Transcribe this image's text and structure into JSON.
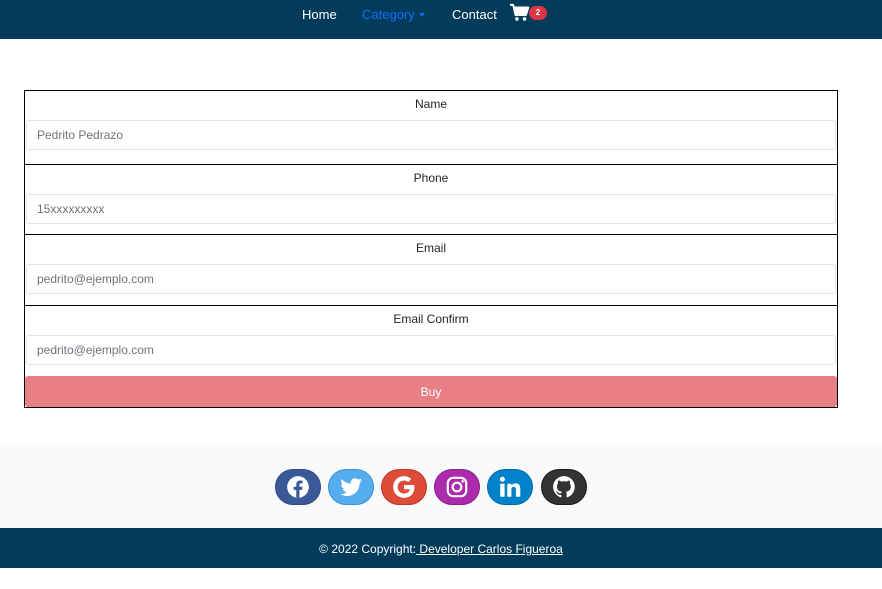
{
  "nav": {
    "home": "Home",
    "category": "Category",
    "contact": "Contact",
    "cart_count": "2"
  },
  "form": {
    "name": {
      "label": "Name",
      "placeholder": "Pedrito Pedrazo"
    },
    "phone": {
      "label": "Phone",
      "placeholder": "15xxxxxxxxx"
    },
    "email": {
      "label": "Email",
      "placeholder": "pedrito@ejemplo.com"
    },
    "email_confirm": {
      "label": "Email Confirm",
      "placeholder": "pedrito@ejemplo.com"
    },
    "buy_label": "Buy"
  },
  "social": {
    "icons": [
      "facebook-icon",
      "twitter-icon",
      "google-icon",
      "instagram-icon",
      "linkedin-icon",
      "github-icon"
    ]
  },
  "footer": {
    "copyright_prefix": "© 2022 Copyright:",
    "developer_link": " Developer Carlos Figueroa"
  },
  "colors": {
    "navbar": "#033c5a",
    "active_link": "#0d6efd",
    "badge": "#dc3545",
    "buy_button": "#e87f86"
  }
}
